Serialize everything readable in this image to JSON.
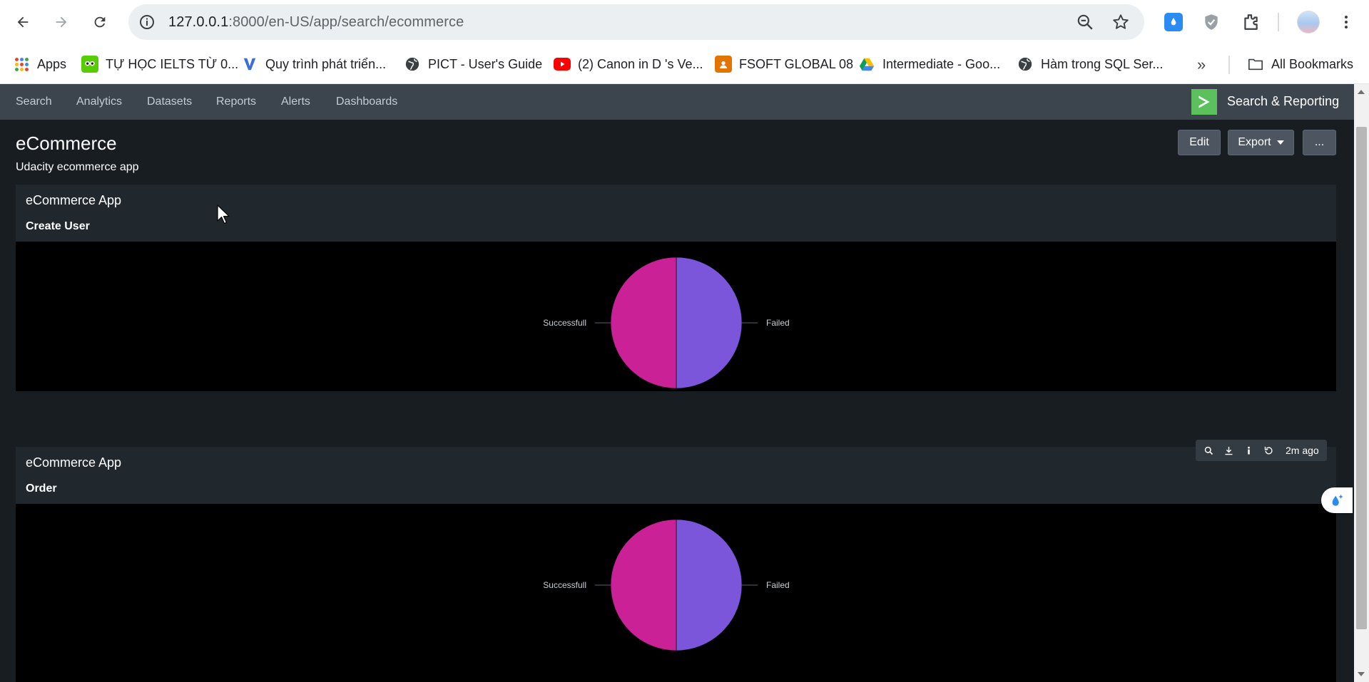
{
  "browser": {
    "url_host": "127.0.0.1",
    "url_path": ":8000/en-US/app/search/ecommerce",
    "bookmarks": [
      {
        "label": "Apps",
        "icon": "apps-grid-icon"
      },
      {
        "label": "TỰ HỌC IELTS TỪ 0...",
        "icon": "owl-icon"
      },
      {
        "label": "Quy trình phát triển...",
        "icon": "v-logo-icon"
      },
      {
        "label": "PICT - User's Guide",
        "icon": "globe-icon"
      },
      {
        "label": "(2) Canon in D 's Ve...",
        "icon": "youtube-icon"
      },
      {
        "label": "FSOFT GLOBAL 08",
        "icon": "classroom-icon"
      },
      {
        "label": "Intermediate - Goo...",
        "icon": "google-drive-icon"
      },
      {
        "label": "Hàm trong SQL Ser...",
        "icon": "globe-icon"
      }
    ],
    "all_bookmarks": "All Bookmarks"
  },
  "appbar": {
    "nav": [
      "Search",
      "Analytics",
      "Datasets",
      "Reports",
      "Alerts",
      "Dashboards"
    ],
    "app_name": "Search & Reporting",
    "logo_color": "#5cc05c"
  },
  "dashboard": {
    "title": "eCommerce",
    "description": "Udacity ecommerce app",
    "buttons": {
      "edit": "Edit",
      "export": "Export",
      "more": "..."
    }
  },
  "panels": [
    {
      "title": "eCommerce App",
      "viz_title": "Create User"
    },
    {
      "title": "eCommerce App",
      "viz_title": "Order"
    }
  ],
  "panel_toolbar": {
    "icons": [
      "search-icon",
      "download-icon",
      "info-icon",
      "refresh-icon"
    ],
    "time_label": "2m ago"
  },
  "chart_data": [
    {
      "type": "pie",
      "title": "Create User",
      "slices": [
        {
          "label": "Failed",
          "value": 50,
          "color": "#7b56db"
        },
        {
          "label": "Successfull",
          "value": 50,
          "color": "#cb2196"
        }
      ]
    },
    {
      "type": "pie",
      "title": "Order",
      "slices": [
        {
          "label": "Failed",
          "value": 50,
          "color": "#7b56db"
        },
        {
          "label": "Successfull",
          "value": 50,
          "color": "#cb2196"
        }
      ]
    }
  ]
}
